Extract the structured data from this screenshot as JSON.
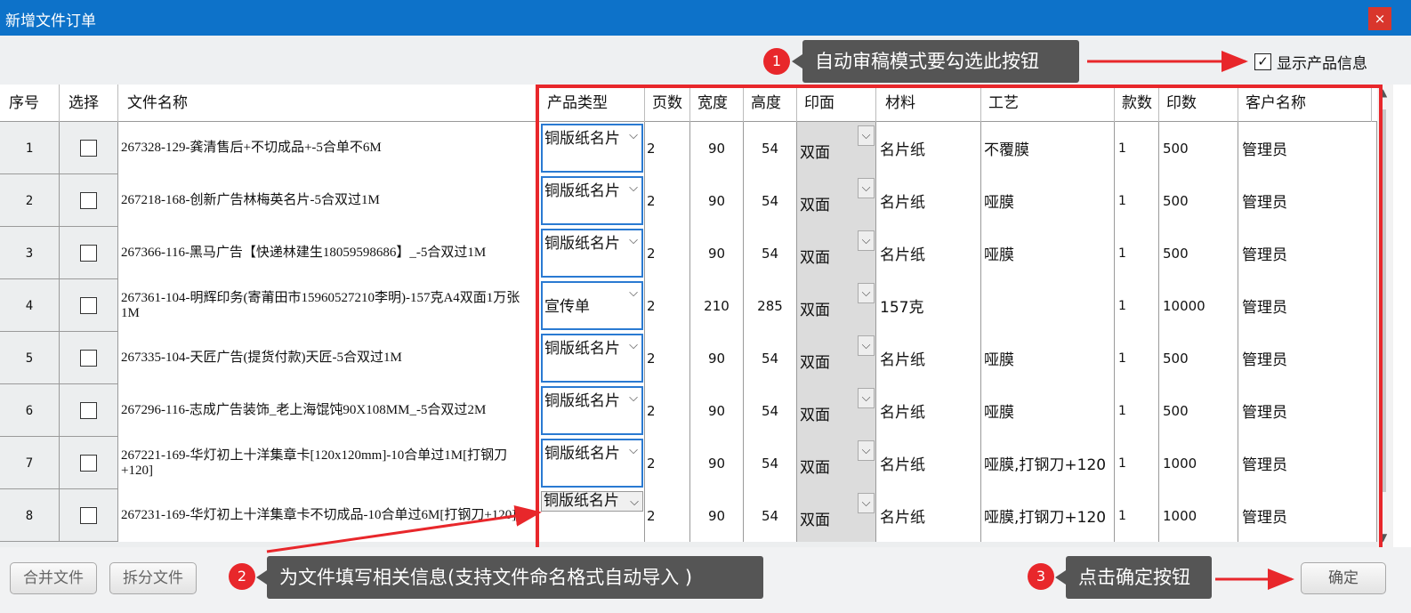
{
  "window": {
    "title": "新增文件订单",
    "close_label": "×"
  },
  "show_product_info": {
    "label": "显示产品信息",
    "checked": true,
    "check_mark": "✓"
  },
  "columns": [
    "序号",
    "选择",
    "文件名称",
    "产品类型",
    "页数",
    "宽度",
    "高度",
    "印面",
    "材料",
    "工艺",
    "款数",
    "印数",
    "客户名称"
  ],
  "rows": [
    {
      "num": "1",
      "name": "267328-129-龚清售后+不切成品+-5合单不6M",
      "type": "铜版纸名片",
      "pages": "2",
      "width": "90",
      "height": "54",
      "side": "双面",
      "material": "名片纸",
      "craft": "不覆膜",
      "count": "1",
      "qty": "500",
      "client": "管理员"
    },
    {
      "num": "2",
      "name": "267218-168-创新广告林梅英名片-5合双过1M",
      "type": "铜版纸名片",
      "pages": "2",
      "width": "90",
      "height": "54",
      "side": "双面",
      "material": "名片纸",
      "craft": "哑膜",
      "count": "1",
      "qty": "500",
      "client": "管理员"
    },
    {
      "num": "3",
      "name": "267366-116-黑马广告【快递林建生18059598686】_-5合双过1M",
      "type": "铜版纸名片",
      "pages": "2",
      "width": "90",
      "height": "54",
      "side": "双面",
      "material": "名片纸",
      "craft": "哑膜",
      "count": "1",
      "qty": "500",
      "client": "管理员"
    },
    {
      "num": "4",
      "name": "267361-104-明辉印务(寄莆田市15960527210李明)-157克A4双面1万张1M",
      "type": "宣传单",
      "pages": "2",
      "width": "210",
      "height": "285",
      "side": "双面",
      "material": "157克",
      "craft": "",
      "count": "1",
      "qty": "10000",
      "client": "管理员"
    },
    {
      "num": "5",
      "name": "267335-104-天匠广告(提货付款)天匠-5合双过1M",
      "type": "铜版纸名片",
      "pages": "2",
      "width": "90",
      "height": "54",
      "side": "双面",
      "material": "名片纸",
      "craft": "哑膜",
      "count": "1",
      "qty": "500",
      "client": "管理员"
    },
    {
      "num": "6",
      "name": "267296-116-志成广告装饰_老上海馄饨90X108MM_-5合双过2M",
      "type": "铜版纸名片",
      "pages": "2",
      "width": "90",
      "height": "54",
      "side": "双面",
      "material": "名片纸",
      "craft": "哑膜",
      "count": "1",
      "qty": "500",
      "client": "管理员"
    },
    {
      "num": "7",
      "name": "267221-169-华灯初上十洋集章卡[120x120mm]-10合单过1M[打钢刀+120]",
      "type": "铜版纸名片",
      "pages": "2",
      "width": "90",
      "height": "54",
      "side": "双面",
      "material": "名片纸",
      "craft": "哑膜,打钢刀+120",
      "count": "1",
      "qty": "1000",
      "client": "管理员"
    },
    {
      "num": "8",
      "name": "267231-169-华灯初上十洋集章卡不切成品-10合单过6M[打钢刀+120]",
      "type": "铜版纸名片",
      "pages": "2",
      "width": "90",
      "height": "54",
      "side": "双面",
      "material": "名片纸",
      "craft": "哑膜,打钢刀+120",
      "count": "1",
      "qty": "1000",
      "client": "管理员"
    }
  ],
  "buttons": {
    "merge": "合并文件",
    "split": "拆分文件",
    "confirm": "确定"
  },
  "callouts": [
    {
      "badge": "1",
      "text": "自动审稿模式要勾选此按钮"
    },
    {
      "badge": "2",
      "text": "为文件填写相关信息(支持文件命名格式自动导入 )"
    },
    {
      "badge": "3",
      "text": "点击确定按钮"
    }
  ],
  "icons": {
    "chevron": "chevron-down-icon",
    "close": "close-icon",
    "check": "checkbox-icon"
  },
  "colors": {
    "titlebar": "#0d72c9",
    "highlight": "#e8272b",
    "callout_bg": "#555555"
  }
}
